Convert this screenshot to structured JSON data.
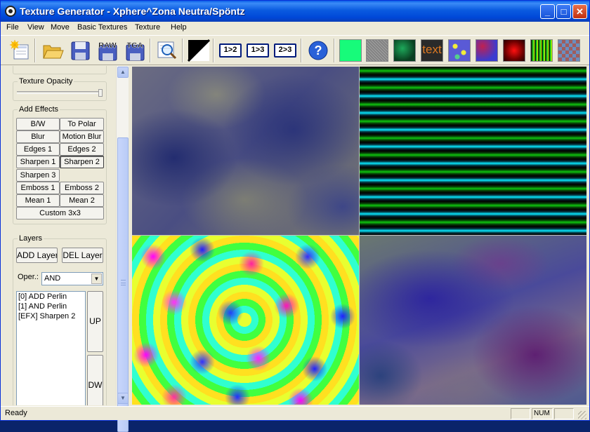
{
  "window": {
    "title": "Texture Generator - Xphere^Zona Neutra/Spöntz"
  },
  "title_buttons": {
    "minimize": "_",
    "maximize": "□",
    "close": "✕"
  },
  "menu": [
    "File",
    "View",
    "Move",
    "Basic Textures",
    "Texture",
    "Help"
  ],
  "toolbar": {
    "buttons": [
      {
        "name": "new-icon"
      },
      {
        "name": "open-folder-icon"
      },
      {
        "name": "save-disk-icon"
      },
      {
        "name": "save-raw-icon",
        "label": "RAW"
      },
      {
        "name": "save-tga-icon",
        "label": "TGA"
      },
      {
        "name": "zoom-preview-icon"
      },
      {
        "name": "invert-icon"
      }
    ],
    "ratios": [
      "1>2",
      "1>3",
      "2>3"
    ],
    "help_label": "?",
    "swatches": [
      {
        "name": "swatch-flat-green",
        "color": "#17fb7a"
      },
      {
        "name": "swatch-noise",
        "color": "#8e8e8e"
      },
      {
        "name": "swatch-green-blur",
        "color": "#0d5a2c"
      },
      {
        "name": "swatch-text",
        "label": "text",
        "color": "#e07a22"
      },
      {
        "name": "swatch-cells",
        "color": "#5a5ad6"
      },
      {
        "name": "swatch-plasma",
        "color": "#c02050"
      },
      {
        "name": "swatch-radial",
        "color": "#e00010"
      },
      {
        "name": "swatch-stripes",
        "color": "#2bd11a"
      },
      {
        "name": "swatch-checker",
        "color": "#8a6a60"
      }
    ]
  },
  "opacity": {
    "label": "Texture Opacity"
  },
  "effects": {
    "label": "Add Effects",
    "buttons": [
      {
        "label": "B/W"
      },
      {
        "label": "To Polar"
      },
      {
        "label": "Blur"
      },
      {
        "label": "Motion Blur"
      },
      {
        "label": "Edges 1"
      },
      {
        "label": "Edges 2"
      },
      {
        "label": "Sharpen 1"
      },
      {
        "label": "Sharpen 2",
        "pressed": true
      },
      {
        "label": "Sharpen 3"
      },
      {
        "label": "Emboss 1"
      },
      {
        "label": "Emboss 2"
      },
      {
        "label": "Mean 1"
      },
      {
        "label": "Mean 2"
      },
      {
        "label": "Custom 3x3"
      }
    ]
  },
  "layers": {
    "label": "Layers",
    "add_label": "ADD Layer",
    "del_label": "DEL Layer",
    "oper_label": "Oper.:",
    "oper_value": "AND",
    "items": [
      "[0] ADD Perlin",
      "[1] AND Perlin",
      "[EFX] Sharpen 2"
    ],
    "up_label": "UP",
    "down_label": "DW"
  },
  "status": {
    "text": "Ready",
    "num": "NUM"
  },
  "colors": {
    "title_blue": "#0a5be0",
    "window_bg": "#ece9d8",
    "border_blue": "#0831d9"
  }
}
